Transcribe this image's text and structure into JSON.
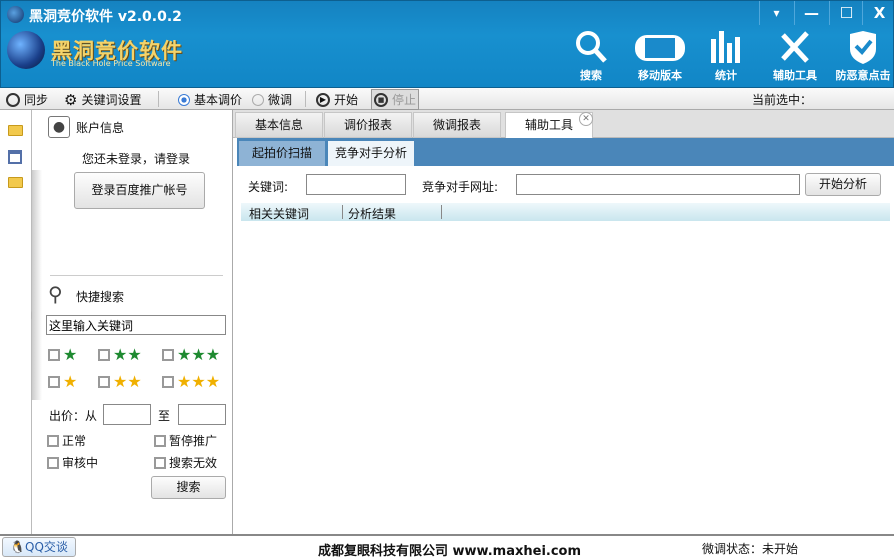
{
  "window": {
    "title": "黑洞竞价软件 v2.0.0.2",
    "controls": [
      "▾",
      "—",
      "☐",
      "X"
    ]
  },
  "logo": {
    "name": "黑洞竞价软件",
    "subtitle": "The Black Hole Price Software"
  },
  "top_buttons": [
    {
      "label": "搜索",
      "icon": "search-icon"
    },
    {
      "label": "移动版本",
      "icon": "mobile-icon"
    },
    {
      "label": "统计",
      "icon": "chart-icon"
    },
    {
      "label": "辅助工具",
      "icon": "tools-icon"
    },
    {
      "label": "防恶意点击",
      "icon": "shield-icon"
    }
  ],
  "toolbar": {
    "sync": "同步",
    "keyword_settings": "关键词设置",
    "basic_adjust": "基本调价",
    "micro_adjust": "微调",
    "start": "开始",
    "stop": "停止",
    "current_selection": "当前选中："
  },
  "account": {
    "title": "账户信息",
    "status": "您还未登录，请登录",
    "login_button": "登录百度推广帐号"
  },
  "quick_search": {
    "title": "快捷搜索",
    "keyword_placeholder": "这里输入关键词",
    "bid_label": "出价：从",
    "to_label": "至",
    "filters": [
      "正常",
      "暂停推广",
      "审核中",
      "搜索无效"
    ],
    "search_button": "搜索",
    "star_ratings": {
      "green": [
        1,
        2,
        3
      ],
      "yellow": [
        1,
        2,
        3
      ]
    }
  },
  "tabs": [
    "基本信息",
    "调价报表",
    "微调报表",
    "辅助工具"
  ],
  "active_tab": "辅助工具",
  "subtabs": [
    "起拍价扫描",
    "竞争对手分析"
  ],
  "form": {
    "keyword_label": "关键词:",
    "keyword_value": "",
    "competitor_label": "竞争对手网址:",
    "competitor_value": "",
    "start_button": "开始分析"
  },
  "grid": {
    "columns": [
      "相关关键词",
      "分析结果"
    ]
  },
  "footer": {
    "qq": "QQ交谈",
    "company": "成都复眼科技有限公司 www.maxhei.com",
    "status": "微调状态：未开始"
  }
}
